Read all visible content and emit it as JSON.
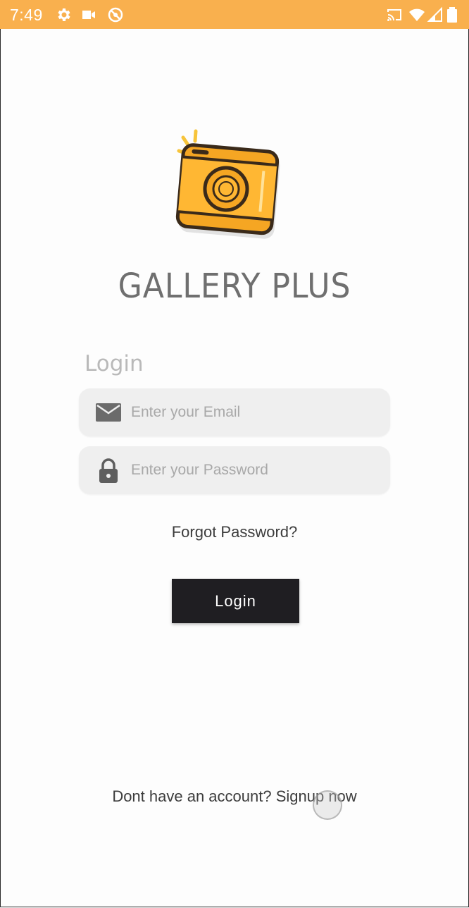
{
  "status_bar": {
    "time": "7:49",
    "background": "#f9b04e",
    "left_icons": [
      "settings-icon",
      "video-camera-icon",
      "do-not-disturb-icon"
    ],
    "right_icons": [
      "cast-icon",
      "wifi-icon",
      "cell-signal-icon",
      "battery-icon"
    ]
  },
  "app": {
    "title": "GALLERY PLUS",
    "logo_icon": "camera-logo-icon",
    "brand_color": "#f9a825"
  },
  "login_form": {
    "heading": "Login",
    "email": {
      "placeholder": "Enter your Email",
      "value": "",
      "icon": "mail-icon"
    },
    "password": {
      "placeholder": "Enter your Password",
      "value": "",
      "icon": "lock-icon"
    },
    "forgot_label": "Forgot Password?",
    "submit_label": "Login"
  },
  "footer": {
    "signup_text": "Dont have an account? Signup now"
  }
}
